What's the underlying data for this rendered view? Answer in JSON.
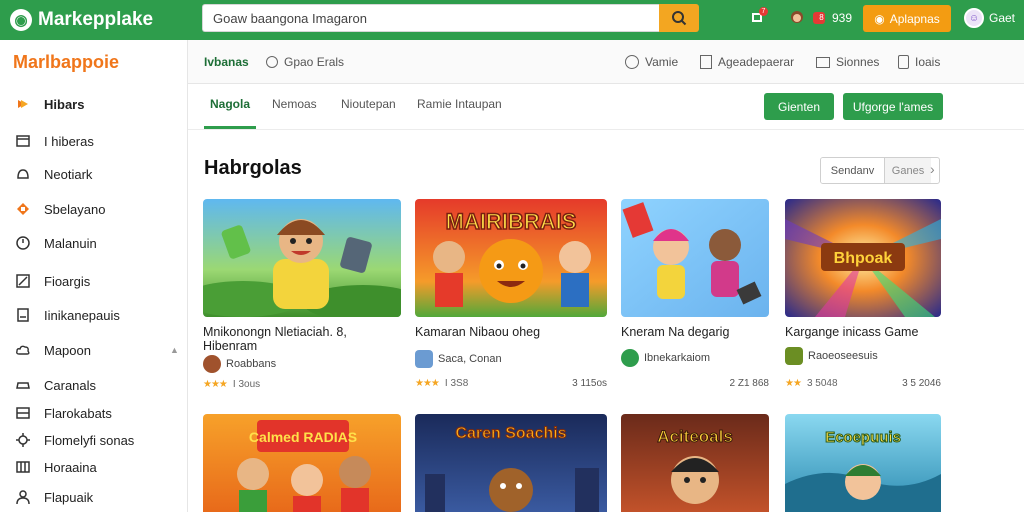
{
  "header": {
    "brand": "Markepplake",
    "search_value": "Goaw baangona Imagaron",
    "badge_counts": [
      "7",
      "8"
    ],
    "stat_text": "939",
    "apps_label": "Aplapnas",
    "user_name": "Gaet"
  },
  "sidebar": {
    "title": "Marlbappoie",
    "items": [
      {
        "label": "Hibars",
        "icon": "flame-icon"
      },
      {
        "label": "I hiberas",
        "icon": "tablet-icon"
      },
      {
        "label": "Neotiark",
        "icon": "bell-icon"
      },
      {
        "label": "Sbelayano",
        "icon": "puzzle-icon"
      },
      {
        "label": "Malanuin",
        "icon": "clock-icon"
      },
      {
        "label": "Fioargis",
        "icon": "chart-icon"
      },
      {
        "label": "Iinikanepauis",
        "icon": "document-icon"
      },
      {
        "label": "Mapoon",
        "icon": "cloud-icon"
      },
      {
        "label": "Caranals",
        "icon": "car-icon"
      },
      {
        "label": "Flarokabats",
        "icon": "box-icon"
      },
      {
        "label": "Flomelyfi sonas",
        "icon": "gear-icon"
      },
      {
        "label": "Horaaina",
        "icon": "grid-icon"
      },
      {
        "label": "Flapuaik",
        "icon": "user-icon"
      }
    ]
  },
  "subnav": {
    "items": [
      "Ivbanas",
      "Gpao Erals",
      "Vamie",
      "Ageadepaerar",
      "Sionnes",
      "Ioais"
    ]
  },
  "tabs": {
    "items": [
      "Nagola",
      "Nemoas",
      "Nioutepan",
      "Ramie Intaupan"
    ],
    "btn_primary": "Gienten",
    "btn_secondary": "Ufgorge l'ames"
  },
  "section": {
    "title": "Habrgolas",
    "toggle_left": "Sendanv",
    "toggle_right": "Ganes"
  },
  "games": [
    {
      "title": "Mnikonongn Nletiaciah.  8, Hibenram",
      "developer": "Roabbans",
      "rating_text": "I 3ous",
      "price": "",
      "art_text": ""
    },
    {
      "title": "Kamaran Nibaou oheg",
      "developer": "Saca, Conan",
      "rating_text": "I 3S8",
      "price": "3 115os",
      "art_text": "MAIRIBRAIS"
    },
    {
      "title": "Kneram Na degarig",
      "developer": "Ibnekarkaiom",
      "rating_text": "",
      "price": "2 Z1 868",
      "art_text": ""
    },
    {
      "title": "Kargange inicass Game",
      "developer": "Raoeoseesuis",
      "rating_text": "3 5048",
      "price": "3 5 2046",
      "art_text": "Bhpoak"
    },
    {
      "title": "",
      "developer": "",
      "rating_text": "",
      "price": "",
      "art_text": "Calmed RADIAS"
    },
    {
      "title": "",
      "developer": "",
      "rating_text": "",
      "price": "",
      "art_text": "Caren Soachis"
    },
    {
      "title": "",
      "developer": "",
      "rating_text": "",
      "price": "",
      "art_text": "Aciteoals"
    },
    {
      "title": "",
      "developer": "",
      "rating_text": "",
      "price": "",
      "art_text": "Ecoepuuis"
    }
  ],
  "colors": {
    "brand_green": "#2e9d4c",
    "accent_orange": "#f39c12",
    "sidebar_title": "#f0761b",
    "star": "#f5a623"
  }
}
